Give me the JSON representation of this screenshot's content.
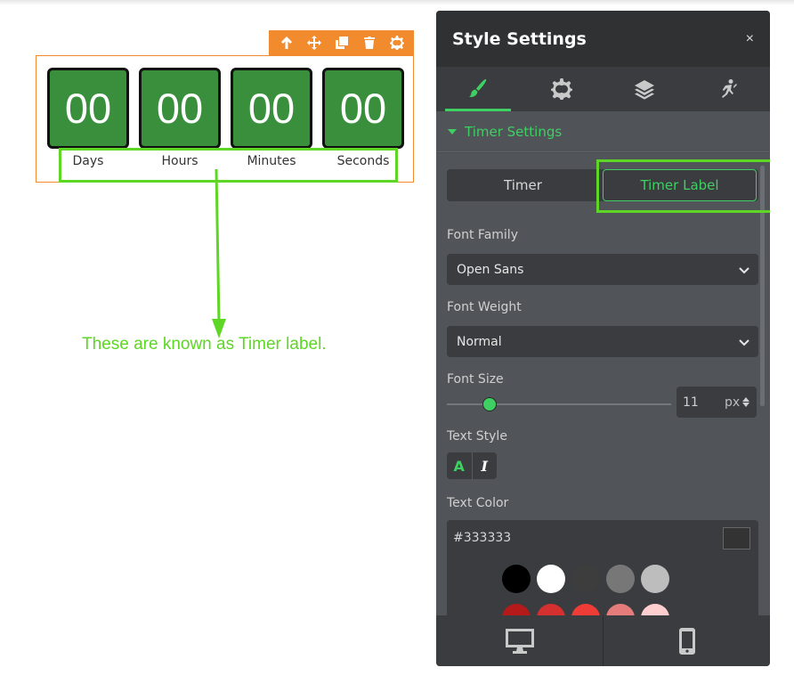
{
  "timer": {
    "values": [
      "00",
      "00",
      "00",
      "00"
    ],
    "labels": [
      "Days",
      "Hours",
      "Minutes",
      "Seconds"
    ],
    "toolbar_icons": [
      "arrow-up-icon",
      "move-icon",
      "duplicate-icon",
      "trash-icon",
      "gear-icon"
    ]
  },
  "annotation": "These are known as Timer label.",
  "panel": {
    "title": "Style Settings",
    "close": "×",
    "tabs": [
      "brush-icon",
      "gear-icon",
      "layers-icon",
      "accessibility-icon"
    ],
    "section_title": "Timer Settings",
    "segment": {
      "timer": "Timer",
      "timer_label": "Timer Label",
      "active": "Timer Label"
    },
    "font_family": {
      "label": "Font Family",
      "value": "Open Sans"
    },
    "font_weight": {
      "label": "Font Weight",
      "value": "Normal"
    },
    "font_size": {
      "label": "Font Size",
      "value": "11",
      "unit": "px",
      "slider_level": 0.19
    },
    "text_style": {
      "label": "Text Style",
      "bold": "A",
      "italic": "I"
    },
    "text_color": {
      "label": "Text Color",
      "value": "#333333"
    },
    "palette": [
      "#000000",
      "#ffffff",
      "#3d3d3d",
      "#777777",
      "#bdbdbd",
      "#b51a1a",
      "#d3302f",
      "#f03c36",
      "#e57c7c",
      "#ffcfcf"
    ],
    "footer": [
      "desktop-icon",
      "mobile-icon"
    ]
  },
  "colors": {
    "accent": "#3ed062",
    "highlight": "#5ed625",
    "timer_bg": "#3a8f3d",
    "toolbar": "#f28a2e"
  }
}
